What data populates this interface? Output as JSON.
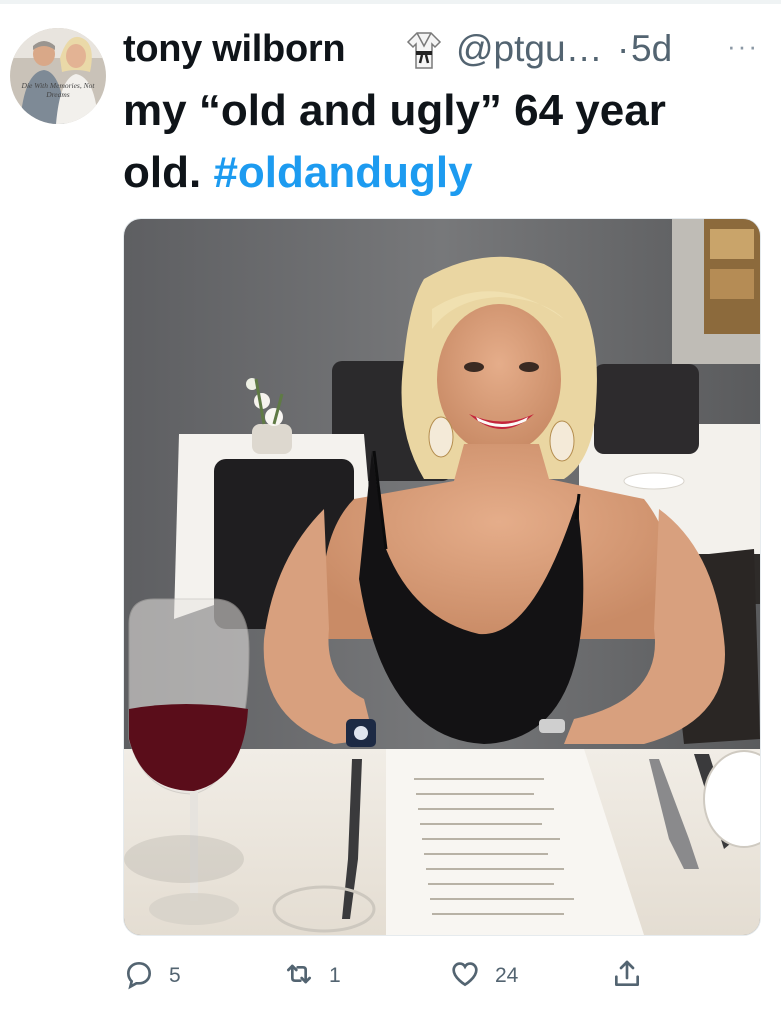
{
  "tweet": {
    "display_name": "tony wilborn",
    "handle": "@ptgu…",
    "separator": "·",
    "time": "5d",
    "more_label": "···",
    "text_main": "my “old and ugly” 64 year old. ",
    "hashtag": "#oldandugly"
  },
  "avatar": {
    "caption_line1": "Die With Memories, Not",
    "caption_line2": "Dreams"
  },
  "photo": {
    "description_icon": "photo-woman-at-restaurant-table"
  },
  "actions": {
    "reply_count": "5",
    "retweet_count": "1",
    "like_count": "24"
  },
  "colors": {
    "text": "#0f1419",
    "secondary": "#536471",
    "hashtag": "#1d9bf0"
  }
}
